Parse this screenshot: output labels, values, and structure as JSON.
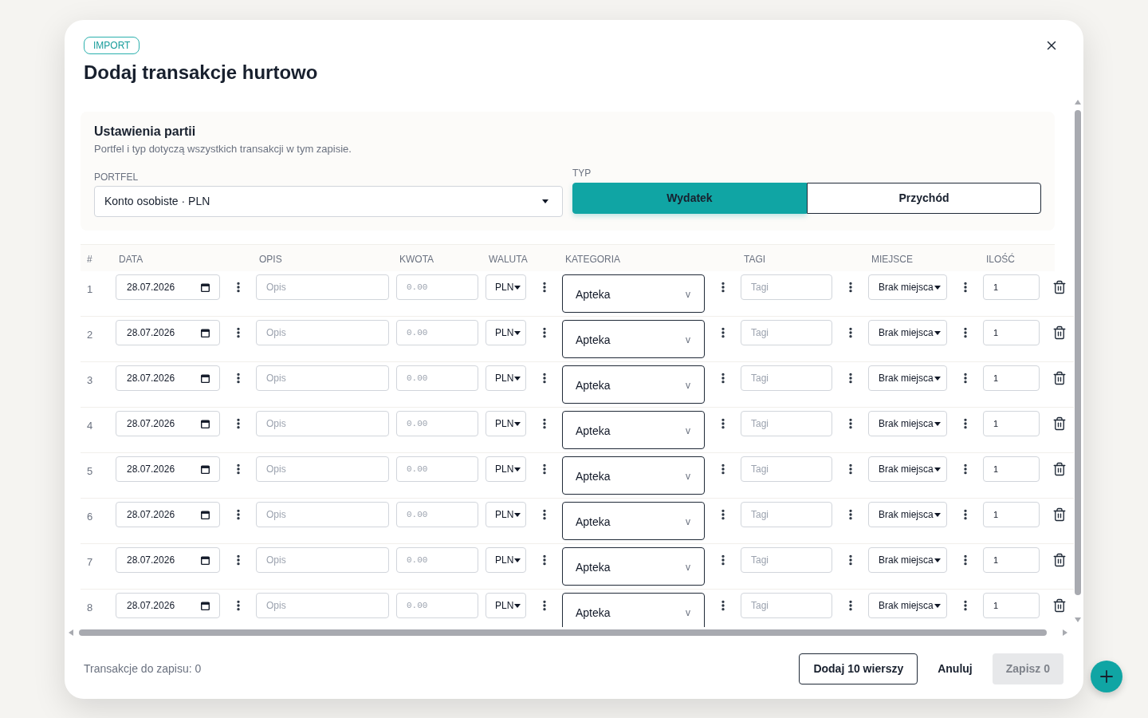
{
  "dialog": {
    "badge": "IMPORT",
    "title": "Dodaj transakcje hurtowo"
  },
  "batch_settings": {
    "title": "Ustawienia partii",
    "description": "Portfel i typ dotyczą wszystkich transakcji w tym zapisie.",
    "wallet": {
      "label": "PORTFEL",
      "value": "Konto osobiste · PLN"
    },
    "type": {
      "label": "TYP",
      "options": [
        {
          "label": "Wydatek",
          "selected": true
        },
        {
          "label": "Przychód",
          "selected": false
        }
      ]
    }
  },
  "table": {
    "columns": [
      "#",
      "DATA",
      "OPIS",
      "KWOTA",
      "WALUTA",
      "KATEGORIA",
      "TAGI",
      "MIEJSCE",
      "ILOŚĆ"
    ],
    "rows": [
      {
        "number": "1",
        "date": "28.07.2026",
        "description": {
          "placeholder": "Opis"
        },
        "amount": {
          "placeholder": "0.00"
        },
        "currency": "PLN",
        "category": "Apteka",
        "category_caret": "v",
        "tags": {
          "placeholder": "Tagi"
        },
        "place": "Brak miejsca",
        "quantity": "1"
      },
      {
        "number": "2",
        "date": "28.07.2026",
        "description": {
          "placeholder": "Opis"
        },
        "amount": {
          "placeholder": "0.00"
        },
        "currency": "PLN",
        "category": "Apteka",
        "category_caret": "v",
        "tags": {
          "placeholder": "Tagi"
        },
        "place": "Brak miejsca",
        "quantity": "1"
      },
      {
        "number": "3",
        "date": "28.07.2026",
        "description": {
          "placeholder": "Opis"
        },
        "amount": {
          "placeholder": "0.00"
        },
        "currency": "PLN",
        "category": "Apteka",
        "category_caret": "v",
        "tags": {
          "placeholder": "Tagi"
        },
        "place": "Brak miejsca",
        "quantity": "1"
      },
      {
        "number": "4",
        "date": "28.07.2026",
        "description": {
          "placeholder": "Opis"
        },
        "amount": {
          "placeholder": "0.00"
        },
        "currency": "PLN",
        "category": "Apteka",
        "category_caret": "v",
        "tags": {
          "placeholder": "Tagi"
        },
        "place": "Brak miejsca",
        "quantity": "1"
      },
      {
        "number": "5",
        "date": "28.07.2026",
        "description": {
          "placeholder": "Opis"
        },
        "amount": {
          "placeholder": "0.00"
        },
        "currency": "PLN",
        "category": "Apteka",
        "category_caret": "v",
        "tags": {
          "placeholder": "Tagi"
        },
        "place": "Brak miejsca",
        "quantity": "1"
      },
      {
        "number": "6",
        "date": "28.07.2026",
        "description": {
          "placeholder": "Opis"
        },
        "amount": {
          "placeholder": "0.00"
        },
        "currency": "PLN",
        "category": "Apteka",
        "category_caret": "v",
        "tags": {
          "placeholder": "Tagi"
        },
        "place": "Brak miejsca",
        "quantity": "1"
      },
      {
        "number": "7",
        "date": "28.07.2026",
        "description": {
          "placeholder": "Opis"
        },
        "amount": {
          "placeholder": "0.00"
        },
        "currency": "PLN",
        "category": "Apteka",
        "category_caret": "v",
        "tags": {
          "placeholder": "Tagi"
        },
        "place": "Brak miejsca",
        "quantity": "1"
      },
      {
        "number": "8",
        "date": "28.07.2026",
        "description": {
          "placeholder": "Opis"
        },
        "amount": {
          "placeholder": "0.00"
        },
        "currency": "PLN",
        "category": "Apteka",
        "category_caret": "v",
        "tags": {
          "placeholder": "Tagi"
        },
        "place": "Brak miejsca",
        "quantity": "1"
      }
    ]
  },
  "footer": {
    "summary": "Transakcje do zapisu: 0",
    "buttons": [
      {
        "label": "Dodaj 10 wierszy",
        "kind": "outline",
        "disabled": false
      },
      {
        "label": "Anuluj",
        "kind": "text",
        "disabled": false
      },
      {
        "label": "Zapisz 0",
        "kind": "primary",
        "disabled": true
      }
    ]
  }
}
